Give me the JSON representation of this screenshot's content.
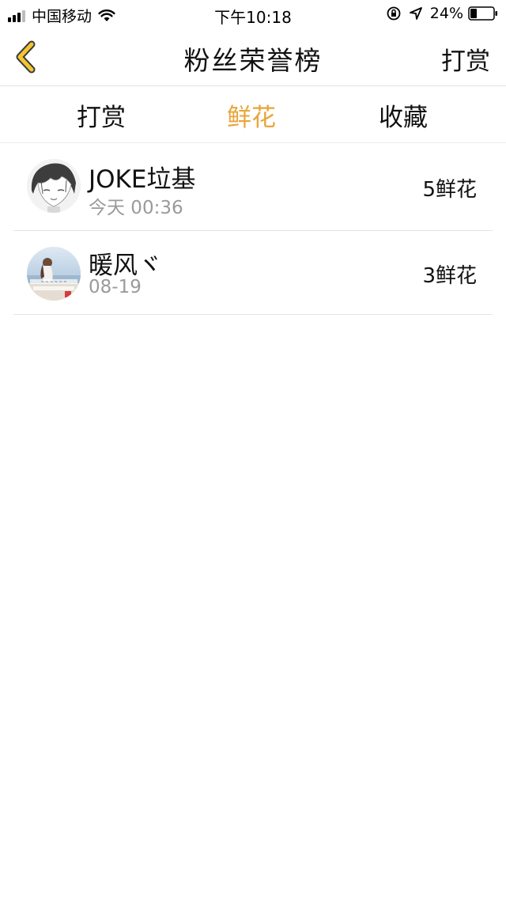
{
  "status_bar": {
    "carrier": "中国移动",
    "time": "下午10:18",
    "battery": "24%"
  },
  "nav": {
    "title": "粉丝荣誉榜",
    "right_action": "打赏"
  },
  "tabs": [
    {
      "label": "打赏",
      "active": false
    },
    {
      "label": "鲜花",
      "active": true
    },
    {
      "label": "收藏",
      "active": false
    }
  ],
  "list": [
    {
      "name": "JOKE垃基",
      "time": "今天 00:36",
      "count": "5鲜花",
      "avatar": "avatar-anime-boy"
    },
    {
      "name": "暖风ヾ",
      "time": "08-19",
      "count": "3鲜花",
      "avatar": "avatar-girl-seaside"
    }
  ],
  "colors": {
    "accent": "#e9a53a",
    "back_arrow": "#f3c530",
    "secondary_text": "#9a9a9a",
    "divider": "#e4e4e4"
  }
}
